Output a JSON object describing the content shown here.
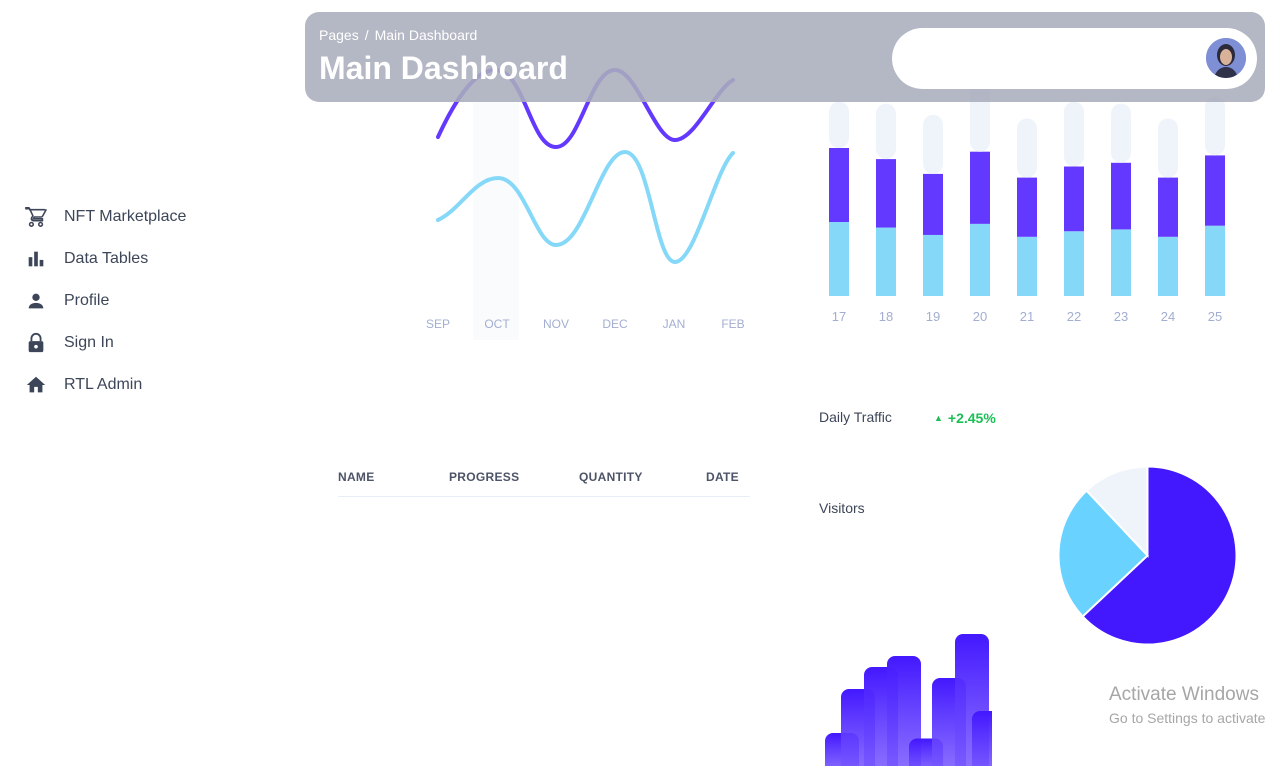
{
  "sidebar": {
    "items": [
      {
        "label": "NFT Marketplace",
        "icon": "cart-icon"
      },
      {
        "label": "Data Tables",
        "icon": "bar-chart-icon"
      },
      {
        "label": "Profile",
        "icon": "person-icon"
      },
      {
        "label": "Sign In",
        "icon": "lock-icon"
      },
      {
        "label": "RTL Admin",
        "icon": "home-icon"
      }
    ]
  },
  "header": {
    "breadcrumb_root": "Pages",
    "breadcrumb_separator": "/",
    "breadcrumb_current": "Main Dashboard",
    "title": "Main Dashboard"
  },
  "colors": {
    "brand": "#4318ff",
    "purple": "#6338ff",
    "cyan": "#6ad2ff",
    "light_cyan": "#86d8f8",
    "track": "#eff4fb",
    "positive": "#1bbf55"
  },
  "line_chart": {
    "months": [
      "SEP",
      "OCT",
      "NOV",
      "DEC",
      "JAN",
      "FEB"
    ]
  },
  "table": {
    "columns": [
      "NAME",
      "PROGRESS",
      "QUANTITY",
      "DATE"
    ]
  },
  "daily_traffic": {
    "label": "Daily Traffic",
    "change": "+2.45%",
    "visitors_label": "Visitors"
  },
  "watermark": {
    "title": "Activate Windows",
    "subtitle": "Go to Settings to activate"
  },
  "chart_data": [
    {
      "type": "bar",
      "stacked": true,
      "categories": [
        "17",
        "18",
        "19",
        "20",
        "21",
        "22",
        "23",
        "24",
        "25"
      ],
      "series": [
        {
          "values": [
            40,
            37,
            33,
            39,
            32,
            35,
            36,
            32,
            38
          ]
        },
        {
          "values": [
            40,
            37,
            33,
            39,
            32,
            35,
            36,
            32,
            38
          ]
        },
        {
          "values": [
            25,
            30,
            32,
            38,
            32,
            35,
            32,
            32,
            32
          ]
        }
      ]
    },
    {
      "type": "pie",
      "slices": [
        {
          "value": 63,
          "color": "#4318ff"
        },
        {
          "value": 25,
          "color": "#6ad2ff"
        },
        {
          "value": 12,
          "color": "#eff4fb"
        }
      ]
    },
    {
      "type": "bar",
      "values": [
        30,
        70,
        90,
        100,
        25,
        80,
        120,
        50
      ]
    }
  ]
}
